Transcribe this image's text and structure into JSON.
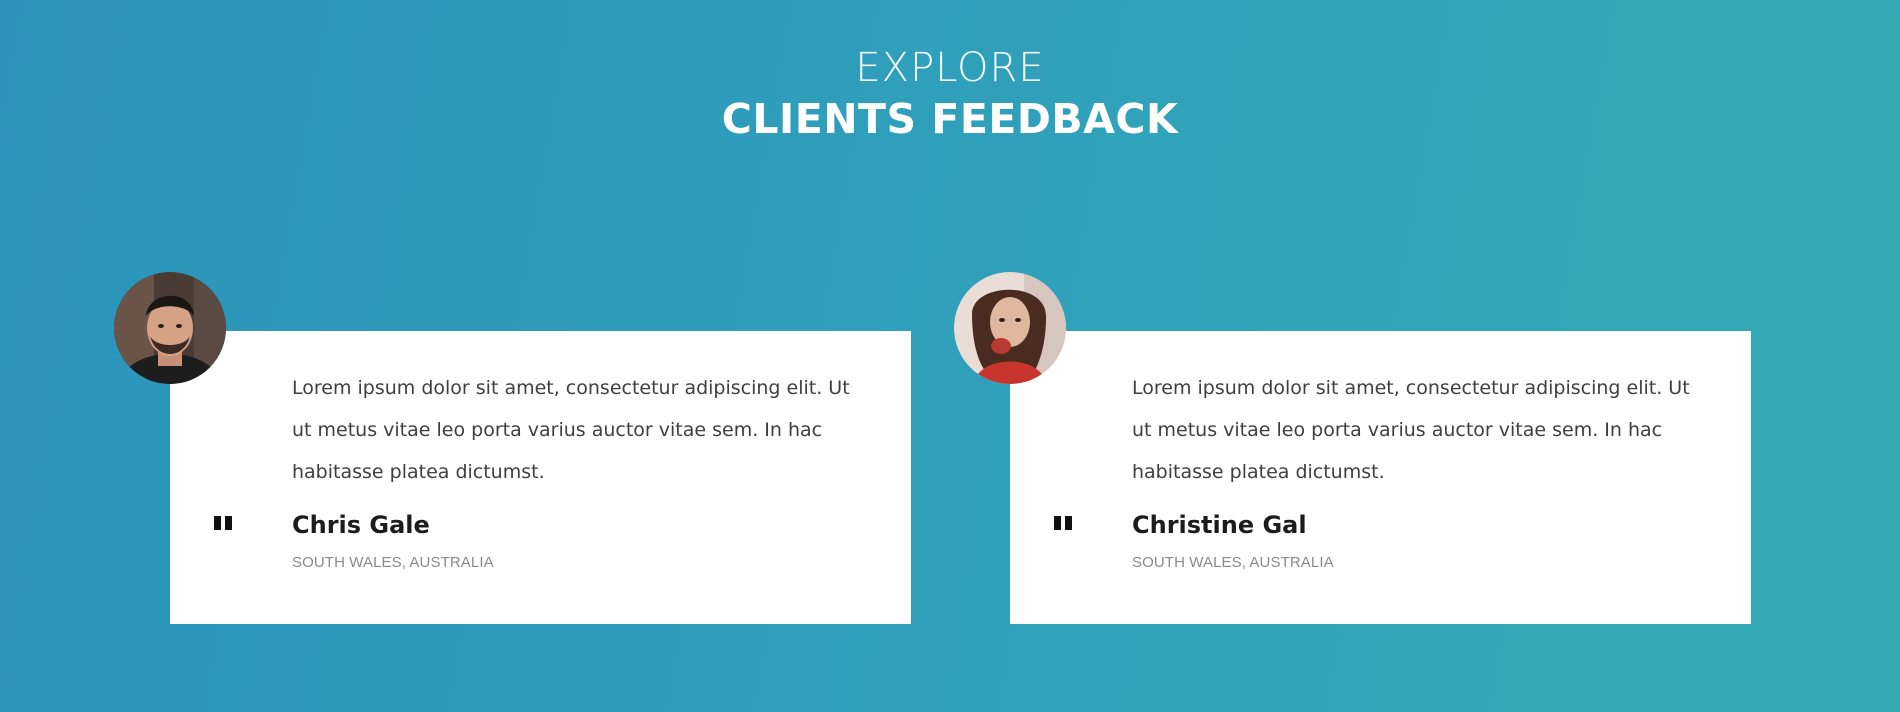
{
  "section": {
    "eyebrow": "EXPLORE",
    "title": "CLIENTS FEEDBACK"
  },
  "testimonials": [
    {
      "text": "Lorem ipsum dolor sit amet, consectetur adipiscing elit. Ut ut metus vitae leo porta varius auctor vitae sem. In hac habitasse platea dictumst.",
      "name": "Chris Gale",
      "location": "SOUTH WALES, AUSTRALIA",
      "avatar_icon": "man-portrait-icon"
    },
    {
      "text": "Lorem ipsum dolor sit amet, consectetur adipiscing elit. Ut ut metus vitae leo porta varius auctor vitae sem. In hac habitasse platea dictumst.",
      "name": "Christine Gal",
      "location": "SOUTH WALES, AUSTRALIA",
      "avatar_icon": "woman-portrait-icon"
    }
  ],
  "colors": {
    "background_start": "#2b93bb",
    "background_end": "#34abb4",
    "card": "#ffffff",
    "name": "#1c1c1c",
    "location": "#8a8a8a"
  }
}
